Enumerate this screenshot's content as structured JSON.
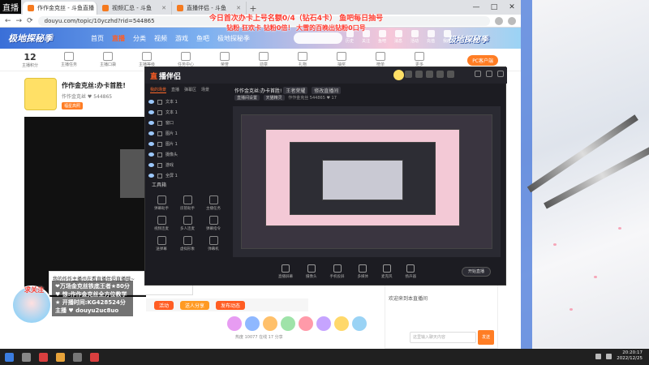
{
  "browser": {
    "tabs": [
      {
        "label": "作作金克丝 - 斗鱼直播",
        "active": true
      },
      {
        "label": "视频汇总 - 斗鱼"
      },
      {
        "label": "直播伴侣 - 斗鱼"
      }
    ],
    "new_tab": "+",
    "url": "douyu.com/topic/10yczhd?rid=544865",
    "window_controls": [
      "—",
      "□",
      "✕"
    ],
    "nav": [
      "←",
      "→",
      "⟳"
    ]
  },
  "douyu": {
    "logo": "极地探秘季",
    "nav": [
      "首页",
      "直播",
      "分类",
      "视频",
      "游戏",
      "鱼吧",
      "极地探秘季"
    ],
    "nav_active": 1,
    "right_icons": [
      "历史",
      "关注",
      "鱼吧",
      "消息",
      "活动",
      "充值",
      "我的"
    ],
    "right_logo": "极地探秘季",
    "toolbar_count": "12",
    "toolbar_count_label": "主播积分",
    "toolbar_items": [
      "主播任务",
      "主播口袋",
      "主播等级",
      "任务中心",
      "荣誉",
      "勋章",
      "礼物",
      "抽奖",
      "榜单",
      "更多"
    ],
    "pc_button": "PC客户端",
    "room": {
      "title": "作作金克丝:办卡首胜!",
      "sub": "作作金克丝  ♥ 544865",
      "tag": "福星高照"
    },
    "popup_text": "我的作作主播也在看直播伴侣直播哦~",
    "actions": [
      "活动",
      "送人分享",
      "发布动态"
    ],
    "action_colors": [
      "#ff5d23",
      "#ff9a22",
      "#ff5d23"
    ],
    "gift_colors": [
      "#e79cf2",
      "#8fb8ff",
      "#ffc06a",
      "#9fe3a9",
      "#ff9aa9",
      "#c6a4ff",
      "#ffd86a",
      "#9ad3f5"
    ],
    "room_stats": "热度 10077   在线 17   分享",
    "chat_notice": "欢迎来到本直播间",
    "chat_input_placeholder": "这里输入聊天内容",
    "chat_send": "发送"
  },
  "companion": {
    "logo_mark": "直",
    "logo": "播伴侣",
    "tabs": [
      "我的场景",
      "直播",
      "弹幕区",
      "场景"
    ],
    "tab_active": 0,
    "scenes": [
      "文本 1",
      "文本 1",
      "窗口",
      "图片 1",
      "图片 1",
      "摄像头",
      "游戏",
      "全屏 1"
    ],
    "tools_head": "工具箱",
    "tools": [
      "弹幕助手",
      "房管助手",
      "主播任务",
      "视频连麦",
      "多人连麦",
      "弹幕指令",
      "送弹幕",
      "虚拟形象",
      "弹幕机"
    ],
    "room_title": "作作金克丝:办卡首胜!",
    "room_badge": "王者荣耀",
    "room_edit": "修改直播间",
    "room_meta_badge": "直播间设置",
    "room_meta_badge2": "天猫精灵",
    "room_meta": "作作金克丝  544865  ♥ 17",
    "preview_controls": [
      "直播屏幕",
      "摄像头",
      "手机投屏",
      "多媒体",
      "麦克风",
      "扬声器"
    ],
    "start_button": "开始直播"
  },
  "overlay": {
    "stream_mark": "直播",
    "banner_line1": "今日首次办卡上号名额0/4（钻石4卡）    鱼吧每日抽号",
    "banner_line2": "钻粉 狂欢卡 钻粉0倍！  大雪的百晚出钻粉0口号",
    "follow_tag": "求关注",
    "info_lines": [
      "❤万场金克丝铁底王者★80分",
      "♥ 惊:作作金克丝全方位教学",
      "★ 开播时间:KG428524分",
      "主播 ♥ douyu2uc8uo"
    ]
  },
  "taskbar": {
    "icon_colors": [
      "#3b7de0",
      "#888",
      "#d93f3f",
      "#e8a33a",
      "#777",
      "#d93f3f"
    ],
    "time": "20:20:17",
    "date": "2022/12/25"
  }
}
